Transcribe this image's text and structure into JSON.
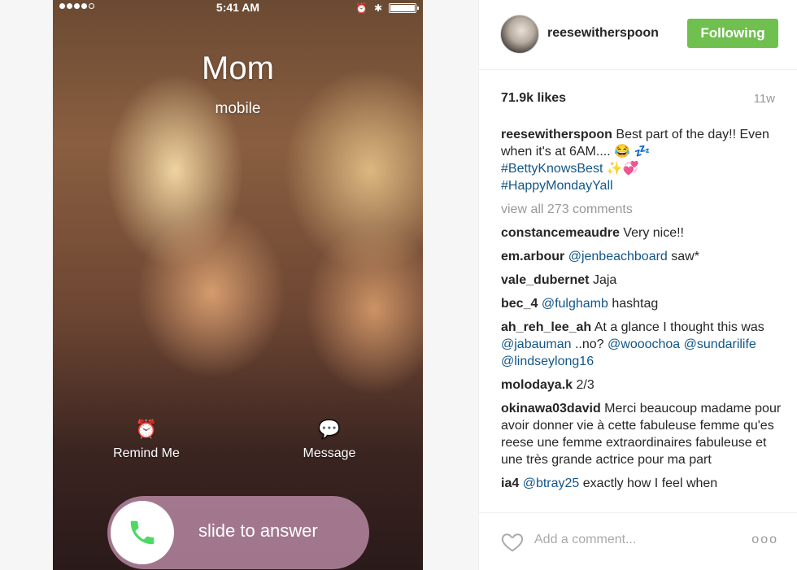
{
  "phone": {
    "time": "5:41 AM",
    "caller_name": "Mom",
    "caller_type": "mobile",
    "remind_label": "Remind Me",
    "message_label": "Message",
    "slide_label": "slide to answer",
    "signal_dots": 5,
    "battery_level": 1.0
  },
  "profile": {
    "username": "reesewitherspoon",
    "follow_label": "Following"
  },
  "post": {
    "likes": "71.9k likes",
    "age": "11w",
    "caption_user": "reesewitherspoon",
    "caption_text": "Best part of the day!! Even when it's at 6AM.... 😂 💤",
    "caption_tag1": "#BettyKnowsBest",
    "caption_tag1_emoji": "✨💞",
    "caption_tag2": "#HappyMondayYall",
    "view_all": "view all 273 comments"
  },
  "comments": [
    {
      "user": "constancemeaudre",
      "text": "Very nice!!"
    },
    {
      "user": "em.arbour",
      "mention": "@jenbeachboard",
      "text": "saw*"
    },
    {
      "user": "vale_dubernet",
      "text": "Jaja"
    },
    {
      "user": "bec_4",
      "mention": "@fulghamb",
      "text": "hashtag"
    },
    {
      "user": "ah_reh_lee_ah",
      "text": "At a glance I thought this was",
      "mention": "@jabauman",
      "text2": "..no?",
      "mention2": "@wooochoa",
      "mention3": "@sundarilife",
      "mention4": "@lindseylong16"
    },
    {
      "user": "molodaya.k",
      "text": "2/3"
    },
    {
      "user": "okinawa03david",
      "text": "Merci beaucoup madame pour avoir donner vie à cette fabuleuse femme qu'es reese une femme extraordinaires fabuleuse et une très grande actrice pour ma part"
    },
    {
      "user": "ia4",
      "mention": "@btray25",
      "text": "exactly how I feel when"
    }
  ],
  "footer": {
    "add_comment_placeholder": "Add a comment...",
    "more_label": "ooo"
  },
  "colors": {
    "follow_button": "#70c050",
    "link": "#125688"
  }
}
